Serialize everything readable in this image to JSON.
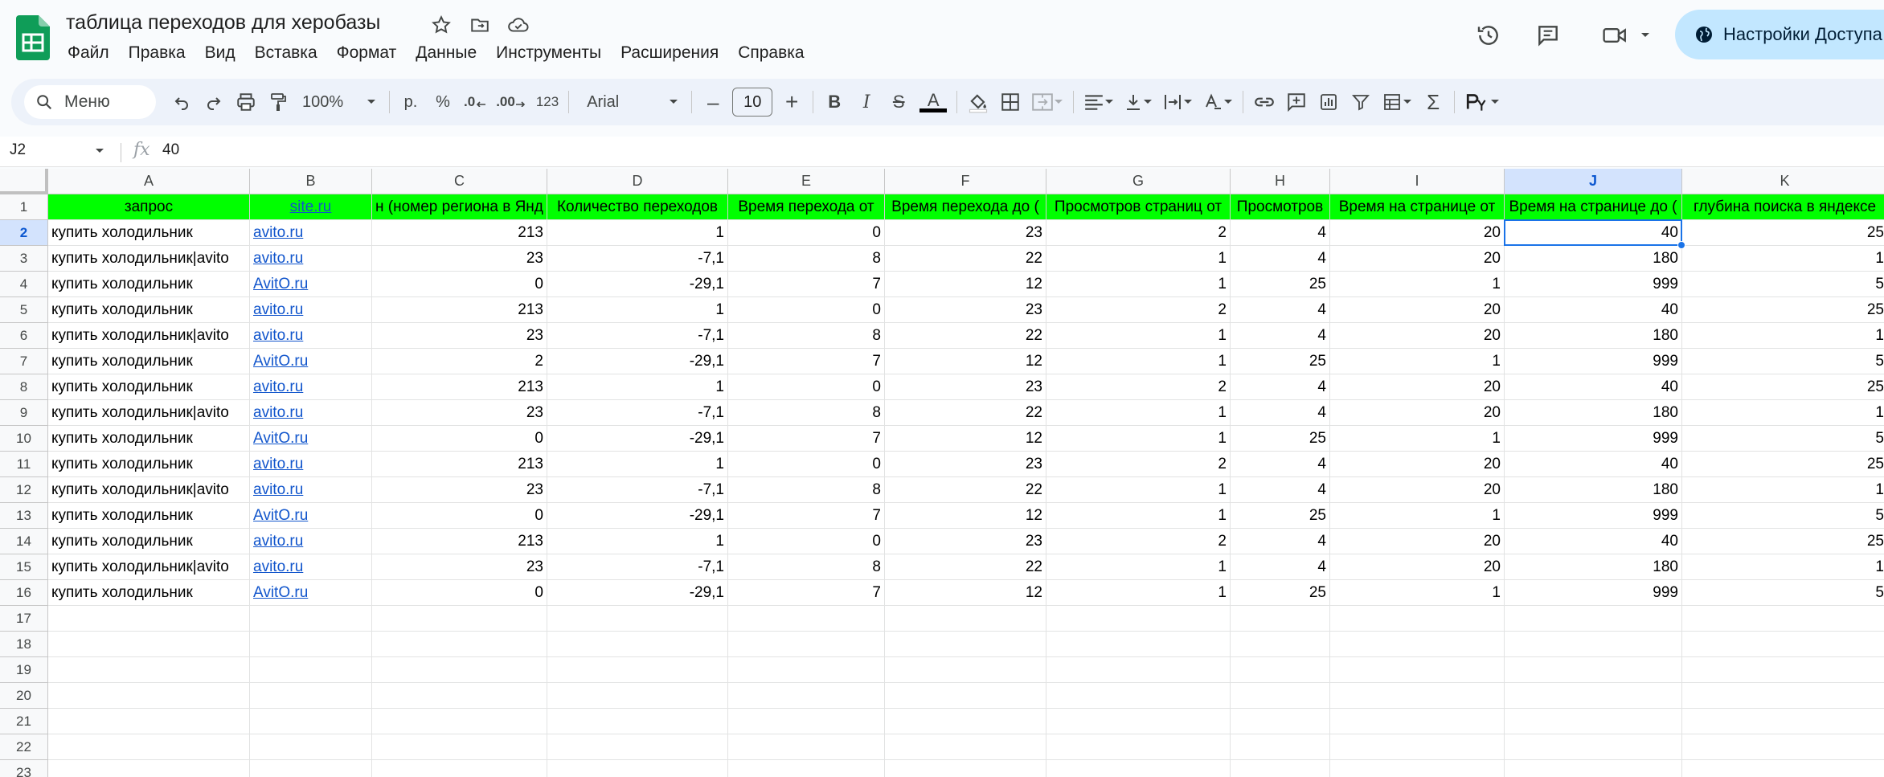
{
  "app": {
    "doc_title": "таблица переходов для херобазы",
    "menus": [
      "Файл",
      "Правка",
      "Вид",
      "Вставка",
      "Формат",
      "Данные",
      "Инструменты",
      "Расширения",
      "Справка"
    ],
    "share_label": "Настройки Доступа",
    "brand_color": "#0f9d58",
    "accent": "#1a73e8"
  },
  "toolbar": {
    "search_label": "Меню",
    "zoom": "100%",
    "currency": "р.",
    "percent": "%",
    "dec_decrease": ".0",
    "dec_increase": ".00",
    "number_format": "123",
    "font": "Arial",
    "font_size": "10",
    "minus": "–",
    "plus": "+",
    "bold": "B",
    "italic": "I",
    "strike": "S",
    "text_color": "A",
    "sigma": "Σ"
  },
  "formula_bar": {
    "name_box": "J2",
    "fx": "fx",
    "value": "40"
  },
  "sheet": {
    "columns": [
      "A",
      "B",
      "C",
      "D",
      "E",
      "F",
      "G",
      "H",
      "I",
      "J",
      "K"
    ],
    "selected_column": "J",
    "selected_row": 2,
    "header_row": [
      "запрос",
      "site.ru",
      "н (номер региона в Янд",
      "Количество переходов",
      "Время  перехода от",
      "Время перехода до (",
      "Просмотров страниц от",
      "Просмотров",
      "Время на странице от",
      "Время на странице до (",
      "глубина поиска в яндексе"
    ],
    "rows": [
      [
        "купить холодильник",
        "avito.ru",
        "213",
        "1",
        "0",
        "23",
        "2",
        "4",
        "20",
        "40",
        "25"
      ],
      [
        "купить холодильник|avito",
        "avito.ru",
        "23",
        "-7,1",
        "8",
        "22",
        "1",
        "4",
        "20",
        "180",
        "1"
      ],
      [
        "купить холодильник",
        "AvitO.ru",
        "0",
        "-29,1",
        "7",
        "12",
        "1",
        "25",
        "1",
        "999",
        "5"
      ],
      [
        "купить холодильник",
        "avito.ru",
        "213",
        "1",
        "0",
        "23",
        "2",
        "4",
        "20",
        "40",
        "25"
      ],
      [
        "купить холодильник|avito",
        "avito.ru",
        "23",
        "-7,1",
        "8",
        "22",
        "1",
        "4",
        "20",
        "180",
        "1"
      ],
      [
        "купить холодильник",
        "AvitO.ru",
        "2",
        "-29,1",
        "7",
        "12",
        "1",
        "25",
        "1",
        "999",
        "5"
      ],
      [
        "купить холодильник",
        "avito.ru",
        "213",
        "1",
        "0",
        "23",
        "2",
        "4",
        "20",
        "40",
        "25"
      ],
      [
        "купить холодильник|avito",
        "avito.ru",
        "23",
        "-7,1",
        "8",
        "22",
        "1",
        "4",
        "20",
        "180",
        "1"
      ],
      [
        "купить холодильник",
        "AvitO.ru",
        "0",
        "-29,1",
        "7",
        "12",
        "1",
        "25",
        "1",
        "999",
        "5"
      ],
      [
        "купить холодильник",
        "avito.ru",
        "213",
        "1",
        "0",
        "23",
        "2",
        "4",
        "20",
        "40",
        "25"
      ],
      [
        "купить холодильник|avito",
        "avito.ru",
        "23",
        "-7,1",
        "8",
        "22",
        "1",
        "4",
        "20",
        "180",
        "1"
      ],
      [
        "купить холодильник",
        "AvitO.ru",
        "0",
        "-29,1",
        "7",
        "12",
        "1",
        "25",
        "1",
        "999",
        "5"
      ],
      [
        "купить холодильник",
        "avito.ru",
        "213",
        "1",
        "0",
        "23",
        "2",
        "4",
        "20",
        "40",
        "25"
      ],
      [
        "купить холодильник|avito",
        "avito.ru",
        "23",
        "-7,1",
        "8",
        "22",
        "1",
        "4",
        "20",
        "180",
        "1"
      ],
      [
        "купить холодильник",
        "AvitO.ru",
        "0",
        "-29,1",
        "7",
        "12",
        "1",
        "25",
        "1",
        "999",
        "5"
      ]
    ],
    "empty_row_numbers": [
      "17",
      "18",
      "19",
      "20",
      "21",
      "22",
      "23"
    ],
    "header_fill": "#00ff00",
    "link_color": "#1155cc"
  }
}
